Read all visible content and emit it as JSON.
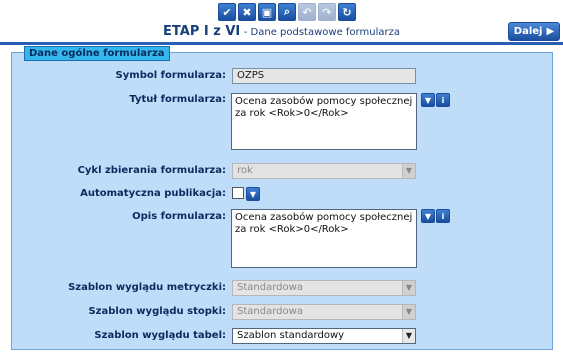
{
  "toolbar": {
    "buttons": [
      {
        "icon": "check-icon",
        "glyph": "✔",
        "enabled": true
      },
      {
        "icon": "close-icon",
        "glyph": "✖",
        "enabled": true
      },
      {
        "icon": "save-icon",
        "glyph": "▣",
        "enabled": true
      },
      {
        "icon": "search-icon",
        "glyph": "⌕",
        "enabled": true
      },
      {
        "icon": "undo-icon",
        "glyph": "↶",
        "enabled": false
      },
      {
        "icon": "redo-icon",
        "glyph": "↷",
        "enabled": false
      },
      {
        "icon": "refresh-icon",
        "glyph": "↻",
        "enabled": true
      }
    ]
  },
  "header": {
    "stage": "ETAP I z VI",
    "subtitle": "- Dane podstawowe formularza",
    "next_label": "Dalej"
  },
  "section": {
    "title": "Dane ogólne formularza"
  },
  "form": {
    "symbol_label": "Symbol formularza:",
    "symbol_value": "OZPS",
    "title_label": "Tytuł formularza:",
    "title_value": "Ocena zasobów pomocy społecznej za rok <Rok>0</Rok>",
    "cycle_label": "Cykl zbierania formularza:",
    "cycle_value": "rok",
    "autopub_label": "Automatyczna publikacja:",
    "desc_label": "Opis formularza:",
    "desc_value": "Ocena zasobów pomocy społecznej za rok <Rok>0</Rok>",
    "metric_label": "Szablon wyglądu metryczki:",
    "metric_value": "Standardowa",
    "footer_label": "Szablon wyglądu stopki:",
    "footer_value": "Standardowa",
    "table_label": "Szablon wyglądu tabel:",
    "table_value": "Szablon standardowy"
  }
}
